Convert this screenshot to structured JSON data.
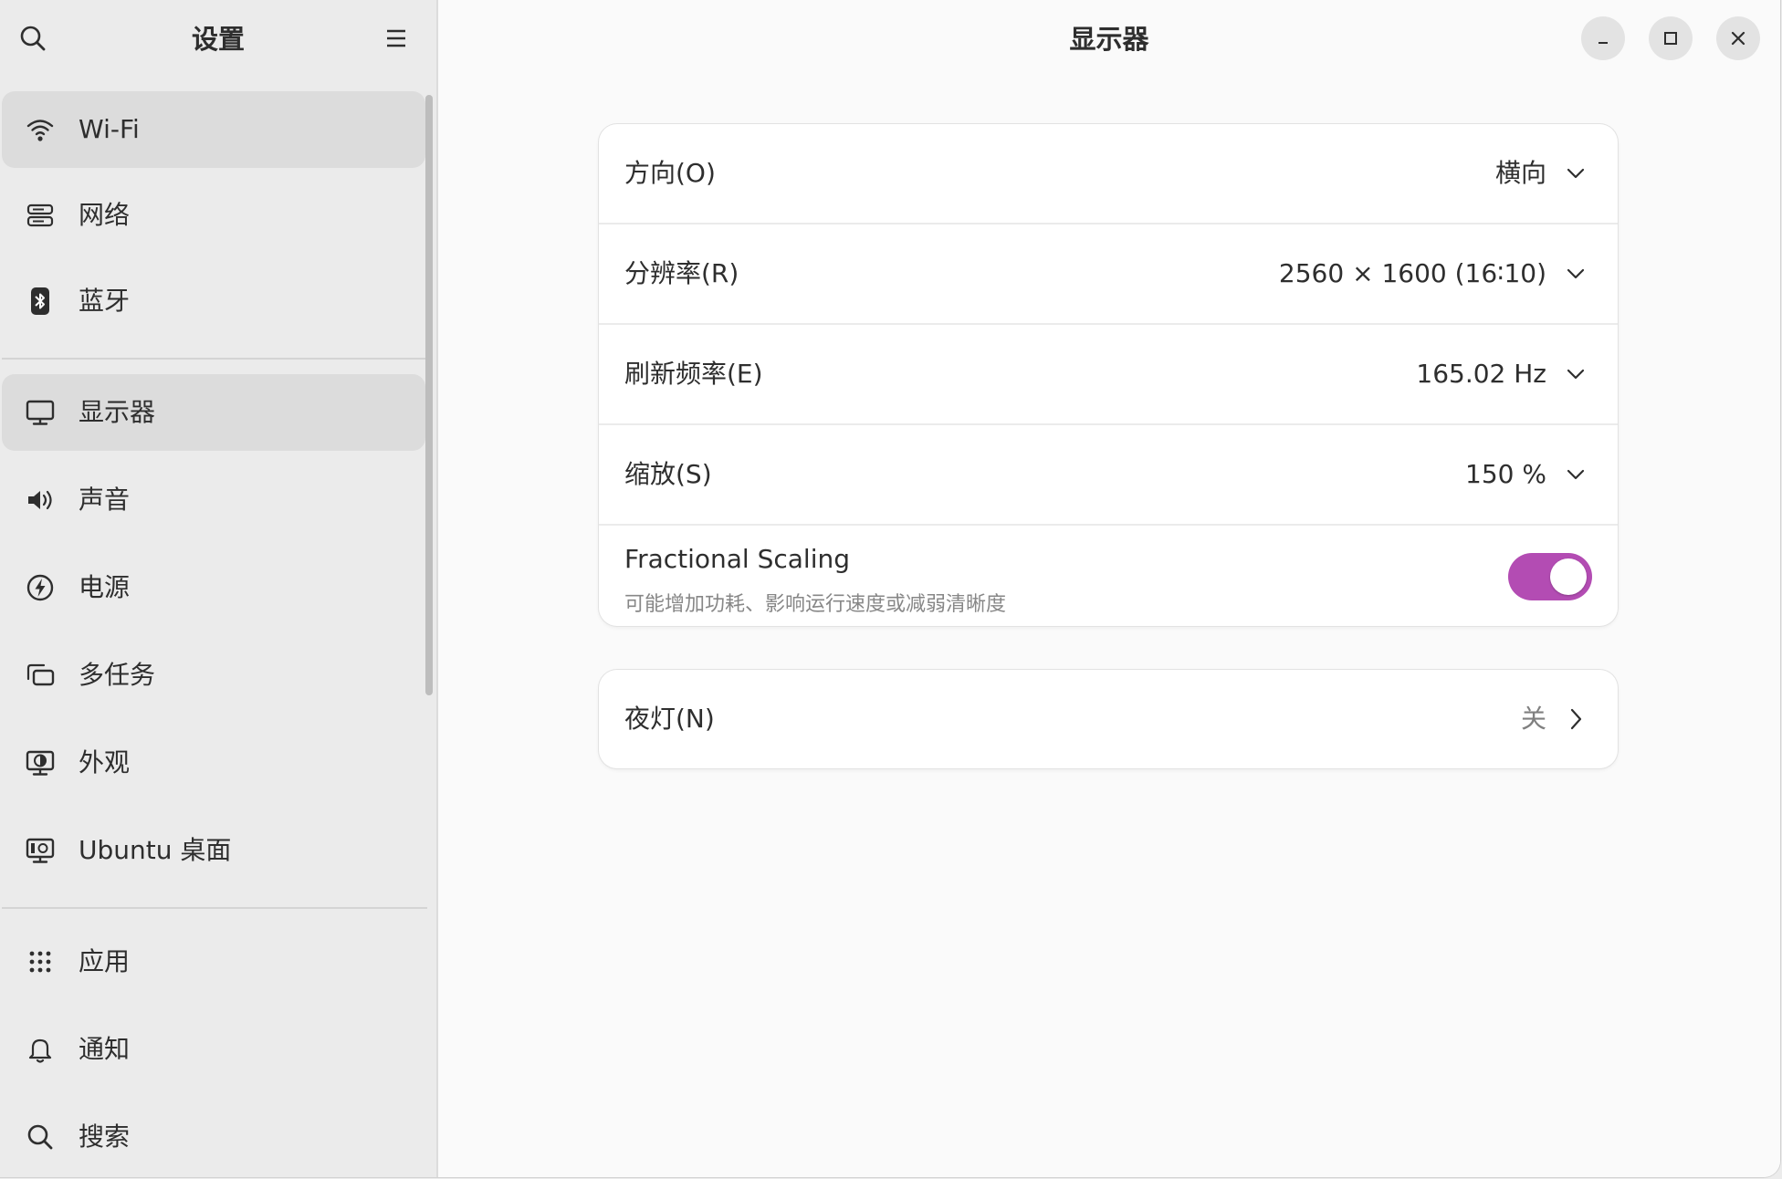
{
  "colors": {
    "accent": "#b34cb3",
    "sidebar_bg": "#ebebeb",
    "selected_bg": "#dcdcdc",
    "content_bg": "#fafafa"
  },
  "sidebar": {
    "title": "设置",
    "search_icon": "search-icon",
    "menu_icon": "hamburger-menu-icon",
    "groups": [
      {
        "items": [
          {
            "label": "Wi-Fi",
            "icon": "wifi-icon",
            "selected": true
          },
          {
            "label": "网络",
            "icon": "network-icon"
          },
          {
            "label": "蓝牙",
            "icon": "bluetooth-icon"
          }
        ]
      },
      {
        "items": [
          {
            "label": "显示器",
            "icon": "display-icon",
            "selected": true
          },
          {
            "label": "声音",
            "icon": "speaker-icon"
          },
          {
            "label": "电源",
            "icon": "power-icon"
          },
          {
            "label": "多任务",
            "icon": "multitasking-icon"
          },
          {
            "label": "外观",
            "icon": "appearance-icon"
          },
          {
            "label": "Ubuntu 桌面",
            "icon": "ubuntu-desktop-icon"
          }
        ]
      },
      {
        "items": [
          {
            "label": "应用",
            "icon": "apps-grid-icon"
          },
          {
            "label": "通知",
            "icon": "bell-icon"
          },
          {
            "label": "搜索",
            "icon": "search-icon"
          }
        ]
      }
    ]
  },
  "main": {
    "title": "显示器",
    "window_controls": [
      "minimize-icon",
      "maximize-icon",
      "close-icon"
    ],
    "display_card": {
      "rows": [
        {
          "label": "方向(O)",
          "value": "横向"
        },
        {
          "label": "分辨率(R)",
          "value": "2560 × 1600 (16∶10)"
        },
        {
          "label": "刷新频率(E)",
          "value": "165.02 Hz"
        },
        {
          "label": "缩放(S)",
          "value": "150 %"
        }
      ],
      "fractional_scaling": {
        "title": "Fractional Scaling",
        "subtitle": "可能增加功耗、影响运行速度或减弱清晰度",
        "enabled": true
      }
    },
    "night_light": {
      "label": "夜灯(N)",
      "value": "关"
    }
  }
}
